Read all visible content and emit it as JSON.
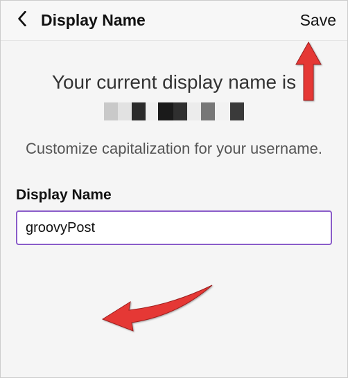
{
  "header": {
    "title": "Display Name",
    "save_label": "Save"
  },
  "main": {
    "intro_line": "Your current display name is",
    "sub_text": "Customize capitalization for your username."
  },
  "field": {
    "label": "Display Name",
    "value": "groovyPost"
  }
}
